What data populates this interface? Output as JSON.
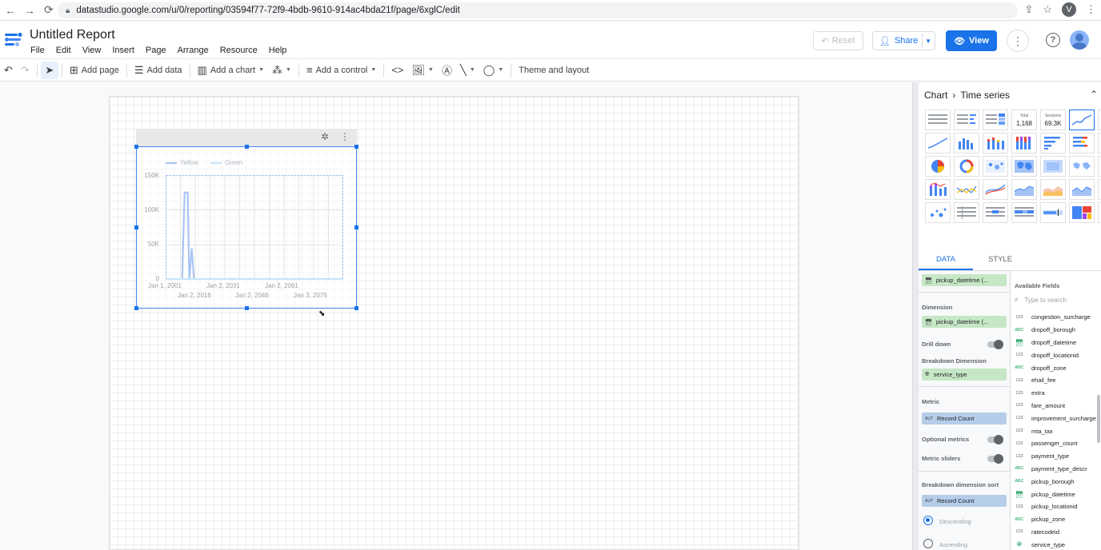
{
  "browser": {
    "url": "datastudio.google.com/u/0/reporting/03594f77-72f9-4bdb-9610-914ac4bda21f/page/6xglC/edit",
    "profile_initial": "V"
  },
  "header": {
    "title": "Untitled Report",
    "menu": [
      "File",
      "Edit",
      "View",
      "Insert",
      "Page",
      "Arrange",
      "Resource",
      "Help"
    ],
    "reset_label": "Reset",
    "share_label": "Share",
    "view_label": "View"
  },
  "toolbar": {
    "add_page": "Add page",
    "add_data": "Add data",
    "add_chart": "Add a chart",
    "add_control": "Add a control",
    "theme_layout": "Theme and layout"
  },
  "chart_data": {
    "type": "line",
    "title": "",
    "series": [
      {
        "name": "Yellow",
        "color": "#a4c2f4",
        "x": [
          "Jan 1, 2001",
          "Jan 2, 2008",
          "Jan 3, 2009",
          "Jan 2, 2010",
          "Jan 2, 2011",
          "Jan 2, 2012",
          "Jan 3, 2013",
          "Jan 2, 2076"
        ],
        "values": [
          0,
          0,
          125000,
          125000,
          0,
          45000,
          0,
          0
        ]
      },
      {
        "name": "Green",
        "color": "#c3e4fa",
        "x": [
          "Jan 1, 2001",
          "Jan 2, 2076"
        ],
        "values": [
          0,
          0
        ]
      }
    ],
    "y_ticks": [
      "150K",
      "100K",
      "50K",
      "0"
    ],
    "ylim": [
      0,
      150000
    ],
    "x_ticks_row1": [
      "Jan 1, 2001",
      "Jan 2, 2031",
      "Jan 2, 2061"
    ],
    "x_ticks_row2": [
      "Jan 2, 2016",
      "Jan 2, 2046",
      "Jan 3, 2076"
    ],
    "grid": true,
    "legend": "top-left"
  },
  "panel": {
    "breadcrumb_root": "Chart",
    "breadcrumb_leaf": "Time series",
    "scorecard_label": "Total",
    "scorecard_value": "1,168",
    "scorecard2_label": "Sessions",
    "scorecard2_value": "69.3K",
    "tabs": [
      "DATA",
      "STYLE"
    ],
    "date_range_field": "pickup_datetime (...",
    "dimension_label": "Dimension",
    "dimension_field": "pickup_datetime (...",
    "drill_down_label": "Drill down",
    "breakdown_label": "Breakdown Dimension",
    "breakdown_field": "service_type",
    "metric_label": "Metric",
    "metric_field": "Record Count",
    "optional_metrics_label": "Optional metrics",
    "metric_sliders_label": "Metric sliders",
    "breakdown_sort_label": "Breakdown dimension sort",
    "breakdown_sort_field": "Record Count",
    "descending_label": "Descending",
    "ascending_label": "Ascending",
    "available_fields_label": "Available Fields",
    "search_placeholder": "Type to search",
    "fields": [
      {
        "type": "123",
        "name": "congestion_surcharge"
      },
      {
        "type": "ABC",
        "name": "dropoff_borough"
      },
      {
        "type": "cal",
        "name": "dropoff_datetime"
      },
      {
        "type": "123",
        "name": "dropoff_locationid"
      },
      {
        "type": "ABC",
        "name": "dropoff_zone"
      },
      {
        "type": "123",
        "name": "ehail_fee"
      },
      {
        "type": "123",
        "name": "extra"
      },
      {
        "type": "123",
        "name": "fare_amount"
      },
      {
        "type": "123",
        "name": "improvement_surcharge"
      },
      {
        "type": "123",
        "name": "mta_tax"
      },
      {
        "type": "123",
        "name": "passenger_count"
      },
      {
        "type": "123",
        "name": "payment_type"
      },
      {
        "type": "ABC",
        "name": "payment_type_descr"
      },
      {
        "type": "ABC",
        "name": "pickup_borough"
      },
      {
        "type": "cal",
        "name": "pickup_datetime"
      },
      {
        "type": "123",
        "name": "pickup_locationid"
      },
      {
        "type": "ABC",
        "name": "pickup_zone"
      },
      {
        "type": "123",
        "name": "ratecodeid"
      },
      {
        "type": "geo",
        "name": "service_type"
      }
    ]
  },
  "colors": {
    "accent": "#1a73e8",
    "dimension_chip": "#c6e7c5",
    "metric_chip": "#b6cdea"
  }
}
